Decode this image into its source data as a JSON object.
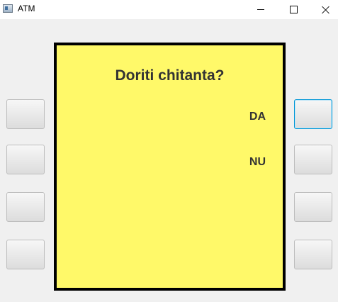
{
  "window": {
    "title": "ATM",
    "icon": "app-window-icon"
  },
  "screen": {
    "prompt": "Doriti chitanta?",
    "options": {
      "yes": "DA",
      "no": "NU"
    },
    "background_color": "#fff969"
  },
  "side_buttons": {
    "left": [
      "",
      "",
      "",
      ""
    ],
    "right": [
      "",
      "",
      "",
      ""
    ],
    "focused": "right-1"
  }
}
